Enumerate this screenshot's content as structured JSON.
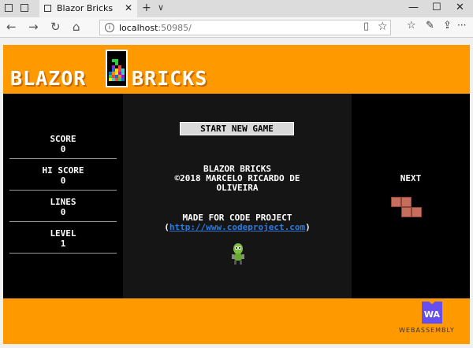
{
  "browser": {
    "tab_title": "Blazor Bricks",
    "tab_close": "✕",
    "new_tab": "+",
    "tab_list": "∨",
    "back": "←",
    "forward": "→",
    "refresh": "↻",
    "home": "⌂",
    "address_host": "localhost",
    "address_port": ":50985/",
    "info_icon": "i",
    "reading_view": "▯",
    "favorite": "☆",
    "favorites_hub": "☆",
    "pen": "✎",
    "share": "⇪",
    "more": "···",
    "minimize": "—",
    "maximize": "☐",
    "close": "✕"
  },
  "app": {
    "logo_left": "BLAZOR",
    "logo_right": "BRICKS",
    "stats": [
      {
        "label": "SCORE",
        "value": "0"
      },
      {
        "label": "HI SCORE",
        "value": "0"
      },
      {
        "label": "LINES",
        "value": "0"
      },
      {
        "label": "LEVEL",
        "value": "1"
      }
    ],
    "start_button": "START NEW GAME",
    "credits_line1": "BLAZOR BRICKS",
    "credits_line2": "©2018 MARCELO RICARDO DE",
    "credits_line3": "OLIVEIRA",
    "made_for": "MADE FOR CODE PROJECT",
    "open_paren": "(",
    "link_text": "http://www.codeproject.com",
    "close_paren": ")",
    "next_label": "NEXT",
    "next_color": "#c56e5e",
    "accent_color": "#ff9900",
    "footer_logo": "WA",
    "footer_text": "WEBASSEMBLY"
  }
}
